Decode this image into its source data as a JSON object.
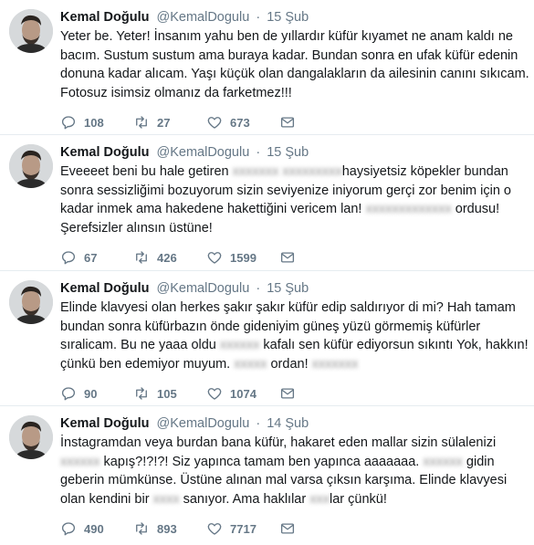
{
  "tweets": [
    {
      "name": "Kemal Doğulu",
      "handle": "@KemalDogulu",
      "separator": "·",
      "time": "15 Şub",
      "segments": [
        {
          "text": "Yeter be. Yeter! İnsanım yahu ben de yıllardır küfür kıyamet ne anam kaldı ne bacım. Sustum sustum ama buraya kadar. Bundan sonra en ufak küfür edenin donuna kadar alıcam. Yaşı küçük olan dangalakların da ailesinin canını sıkıcam. Fotosuz isimsiz olmanız da farketmez!!!"
        }
      ],
      "stats": {
        "replies": "108",
        "retweets": "27",
        "likes": "673"
      }
    },
    {
      "name": "Kemal Doğulu",
      "handle": "@KemalDogulu",
      "separator": "·",
      "time": "15 Şub",
      "segments": [
        {
          "text": "Eveeeet beni bu hale getiren "
        },
        {
          "text": "xxxxxxx xxxxxxxxx",
          "blurred": true
        },
        {
          "text": "haysiyetsiz köpekler bundan sonra sessizliğimi bozuyorum sizin seviyenize iniyorum gerçi zor benim için o kadar inmek ama hakedene hakettiğini vericem lan! "
        },
        {
          "text": "xxxxxxxxxxxxx",
          "blurred": true
        },
        {
          "text": " ordusu! Şerefsizler alınsın üstüne!"
        }
      ],
      "stats": {
        "replies": "67",
        "retweets": "426",
        "likes": "1599"
      }
    },
    {
      "name": "Kemal Doğulu",
      "handle": "@KemalDogulu",
      "separator": "·",
      "time": "15 Şub",
      "segments": [
        {
          "text": "Elinde klavyesi olan herkes şakır şakır küfür edip saldırıyor di mi? Hah tamam bundan sonra küfürbazın önde gideniyim güneş yüzü görmemiş küfürler sıralicam. Bu ne yaaa oldu "
        },
        {
          "text": "xxxxxx",
          "blurred": true
        },
        {
          "text": " kafalı sen küfür ediyorsun sıkıntı Yok, hakkın! çünkü ben edemiyor muyum. "
        },
        {
          "text": "xxxxx",
          "blurred": true
        },
        {
          "text": " ordan! "
        },
        {
          "text": "xxxxxxx",
          "blurred": true
        }
      ],
      "stats": {
        "replies": "90",
        "retweets": "105",
        "likes": "1074"
      }
    },
    {
      "name": "Kemal Doğulu",
      "handle": "@KemalDogulu",
      "separator": "·",
      "time": "14 Şub",
      "segments": [
        {
          "text": "İnstagramdan veya burdan bana küfür, hakaret eden mallar sizin sülalenizi "
        },
        {
          "text": "xxxxxx",
          "blurred": true
        },
        {
          "text": " kapış?!?!?! Siz yapınca tamam ben yapınca aaaaaaa. "
        },
        {
          "text": "xxxxxx",
          "blurred": true
        },
        {
          "text": " gidin geberin mümkünse. Üstüne alınan mal varsa çıksın karşıma. Elinde klavyesi olan kendini bir "
        },
        {
          "text": "xxxx",
          "blurred": true
        },
        {
          "text": " sanıyor. Ama haklılar "
        },
        {
          "text": "xxx",
          "blurred": true
        },
        {
          "text": "lar çünkü!"
        }
      ],
      "stats": {
        "replies": "490",
        "retweets": "893",
        "likes": "7717"
      }
    }
  ],
  "icons": {
    "reply": "reply-icon",
    "retweet": "retweet-icon",
    "like": "heart-icon",
    "message": "envelope-icon"
  },
  "colors": {
    "text": "#14171a",
    "secondary": "#657786",
    "divider": "#e6ecf0"
  }
}
